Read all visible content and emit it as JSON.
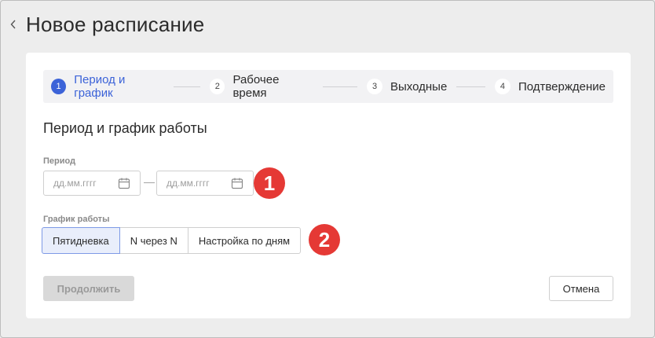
{
  "header": {
    "title": "Новое расписание"
  },
  "stepper": {
    "steps": [
      {
        "number": "1",
        "label": "Период и график"
      },
      {
        "number": "2",
        "label": "Рабочее время"
      },
      {
        "number": "3",
        "label": "Выходные"
      },
      {
        "number": "4",
        "label": "Подтверждение"
      }
    ]
  },
  "form": {
    "section_title": "Период и график работы",
    "period": {
      "label": "Период",
      "start_placeholder": "дд.мм.гггг",
      "separator": "—",
      "end_placeholder": "дд.мм.гггг"
    },
    "schedule": {
      "label": "График работы",
      "options": [
        "Пятидневка",
        "N через N",
        "Настройка по дням"
      ],
      "selected": "Пятидневка"
    },
    "continue_label": "Продолжить",
    "cancel_label": "Отмена"
  },
  "annotations": {
    "badge1": "1",
    "badge2": "2"
  },
  "colors": {
    "accent": "#3c63d8",
    "badge": "#e53935"
  }
}
